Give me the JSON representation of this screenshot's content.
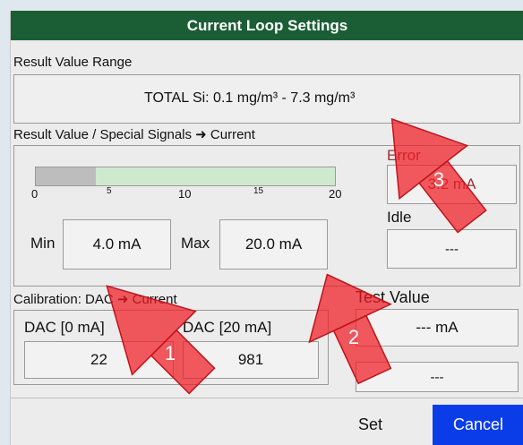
{
  "window": {
    "title": "Current Loop Settings"
  },
  "result_range": {
    "label": "Result Value Range",
    "value": "TOTAL Si:  0.1 mg/m³ - 7.3 mg/m³"
  },
  "mapping": {
    "label": "Result Value / Special Signals ➜ Current",
    "scale": {
      "ticks": [
        "0",
        "5",
        "10",
        "15",
        "20"
      ],
      "fill_start_ma": 4,
      "fill_end_ma": 20,
      "max_ma": 20
    },
    "min_label": "Min",
    "min_value": "4.0 mA",
    "max_label": "Max",
    "max_value": "20.0 mA",
    "error_label": "Error",
    "error_value": "3.2 mA",
    "idle_label": "Idle",
    "idle_value": "---"
  },
  "calibration": {
    "label": "Calibration: DAC ➜ Current",
    "dac0_label": "DAC [0 mA]",
    "dac0_value": "22",
    "dac20_label": "DAC [20 mA]",
    "dac20_value": "981"
  },
  "test": {
    "label": "Test Value",
    "value": "--- mA",
    "secondary": "---"
  },
  "buttons": {
    "set": "Set",
    "cancel": "Cancel"
  },
  "annotations": [
    "1",
    "2",
    "3"
  ],
  "colors": {
    "title_bg": "#1b5e36",
    "cancel_bg": "#0a3de8",
    "range_fill": "#cfe9cf",
    "arrow": "#ee1c24"
  }
}
